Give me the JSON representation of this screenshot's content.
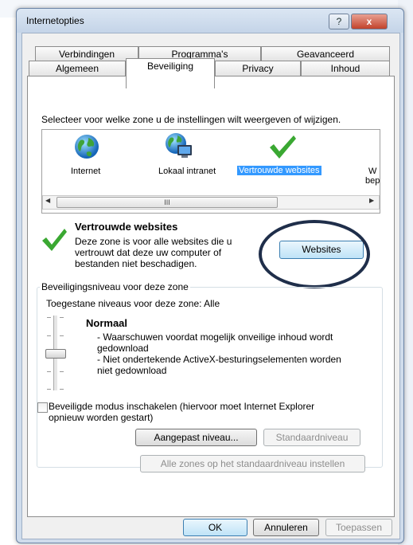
{
  "window": {
    "title": "Internetopties",
    "help_label": "?",
    "close_label": "x"
  },
  "tabs": {
    "row_top": [
      "Verbindingen",
      "Programma's",
      "Geavanceerd"
    ],
    "row_bottom": [
      "Algemeen",
      "Beveiliging",
      "Privacy",
      "Inhoud"
    ]
  },
  "zones": {
    "instruction": "Selecteer voor welke zone u de instellingen wilt weergeven of wijzigen.",
    "items": [
      {
        "label": "Internet",
        "icon": "globe-icon"
      },
      {
        "label": "Lokaal intranet",
        "icon": "intranet-icon"
      },
      {
        "label": "Vertrouwde websites",
        "icon": "checkmark-icon"
      },
      {
        "label": "W",
        "icon": "restricted-icon"
      }
    ],
    "partial_label_line2": "bep",
    "scroll_grip": "III",
    "scroll_left": "◀",
    "scroll_right": "▶"
  },
  "selected_zone": {
    "title": "Vertrouwde websites",
    "description_lines": [
      "Deze zone is voor alle websites die u",
      "vertrouwt dat deze uw computer of",
      "bestanden niet beschadigen."
    ],
    "websites_button": "Websites"
  },
  "security_level": {
    "group_title": "Beveiligingsniveau voor deze zone",
    "allowed_levels": "Toegestane niveaus voor deze zone: Alle",
    "level_name": "Normaal",
    "bullets": [
      "- Waarschuwen voordat mogelijk onveilige inhoud wordt",
      "gedownload",
      "- Niet ondertekende ActiveX-besturingselementen worden",
      "niet gedownload"
    ],
    "protected_mode_line1": "Beveiligde modus inschakelen (hiervoor moet Internet Explorer",
    "protected_mode_line2": "opnieuw worden gestart)",
    "custom_level_button": "Aangepast niveau...",
    "default_level_button": "Standaardniveau",
    "reset_all_button": "Alle zones op het standaardniveau instellen"
  },
  "footer": {
    "ok": "OK",
    "cancel": "Annuleren",
    "apply": "Toepassen"
  },
  "colors": {
    "accent": "#3399ff",
    "highlight_circle": "#1f2e4a",
    "check_green": "#3aa832"
  }
}
